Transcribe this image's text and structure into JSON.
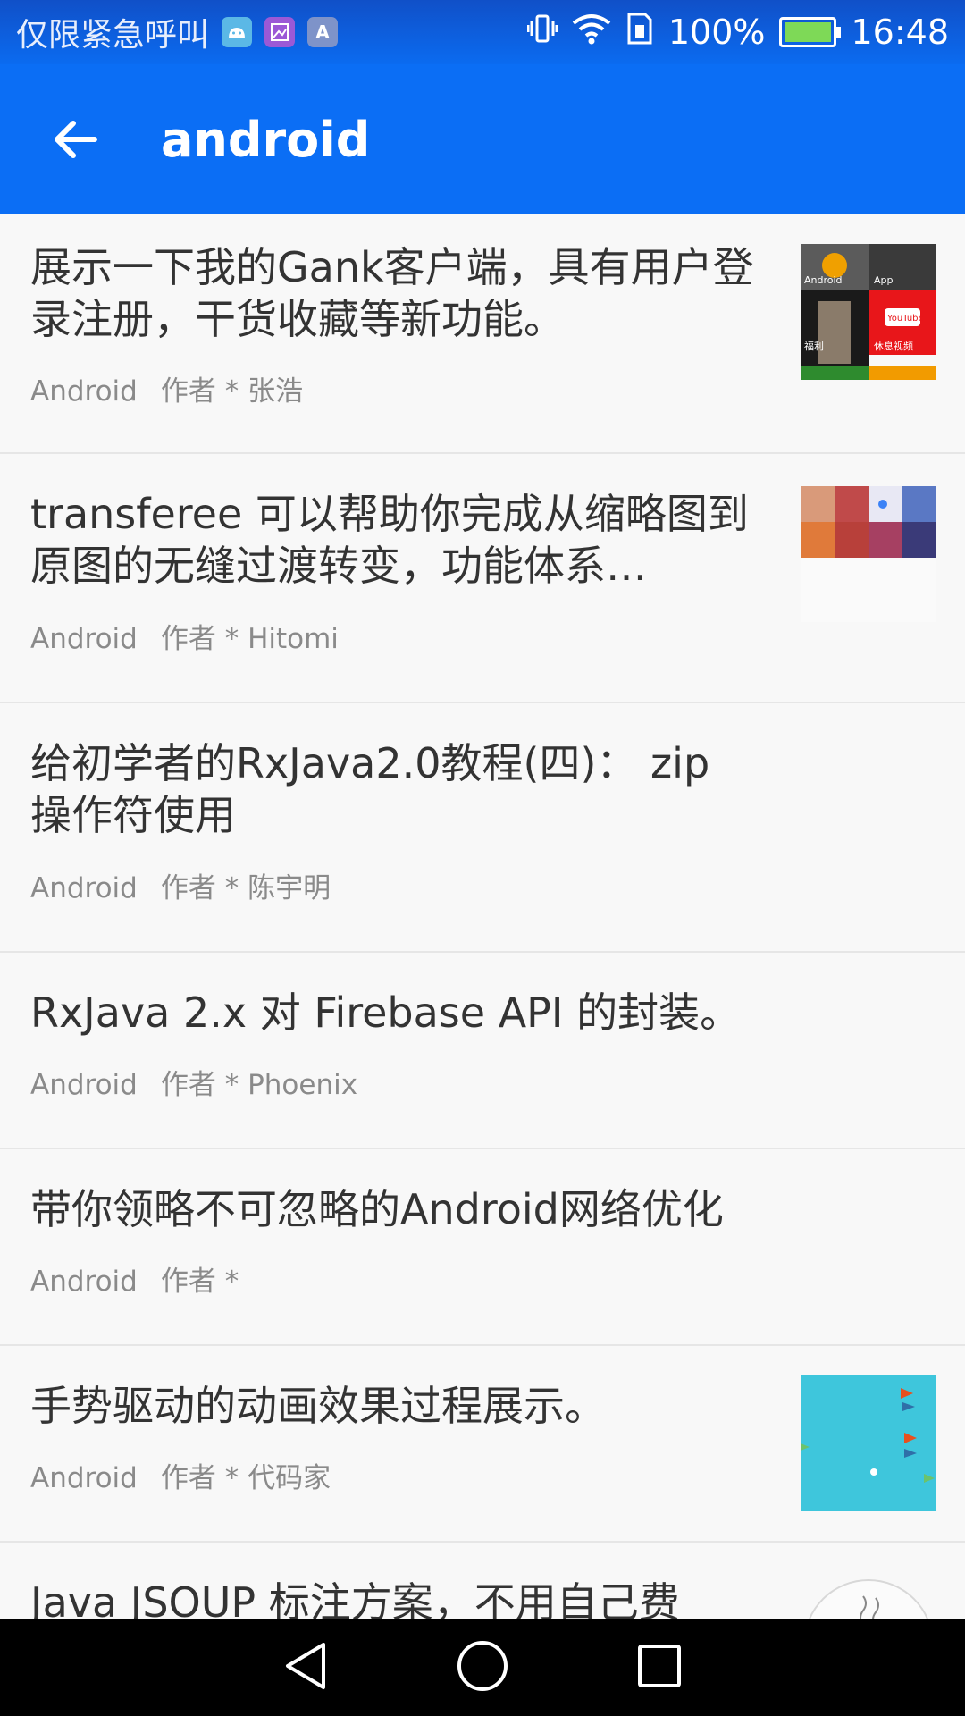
{
  "status_bar": {
    "carrier": "仅限紧急呼叫",
    "notifications": [
      "android-robot-icon",
      "gallery-icon",
      "text-a-icon"
    ],
    "battery": "100%",
    "time": "16:48"
  },
  "toolbar": {
    "title": "android"
  },
  "items": [
    {
      "title": "展示一下我的Gank客户端，具有用户登录注册，干货收藏等新功能。",
      "category": "Android",
      "author": "作者 * 张浩",
      "has_thumb": true
    },
    {
      "title": "transferee 可以帮助你完成从缩略图到原图的无缝过渡转变，功能体系…",
      "category": "Android",
      "author": "作者 * Hitomi",
      "has_thumb": true
    },
    {
      "title": "给初学者的RxJava2.0教程(四)： zip 操作符使用",
      "category": "Android",
      "author": "作者 * 陈宇明",
      "has_thumb": false
    },
    {
      "title": "RxJava 2.x 对 Firebase API 的封装。",
      "category": "Android",
      "author": "作者 * Phoenix",
      "has_thumb": false
    },
    {
      "title": "带你领略不可忽略的Android网络优化",
      "category": "Android",
      "author": "作者 *",
      "has_thumb": false
    },
    {
      "title": "手势驱动的动画效果过程展示。",
      "category": "Android",
      "author": "作者 * 代码家",
      "has_thumb": true
    },
    {
      "title": "Java JSOUP 标注方案，不用自己费",
      "category": "",
      "author": "",
      "has_thumb": true
    }
  ],
  "thumb_labels": {
    "android": "Android",
    "app": "App",
    "youtube": "YouTube",
    "fuli": "福利",
    "video": "休息视频"
  }
}
